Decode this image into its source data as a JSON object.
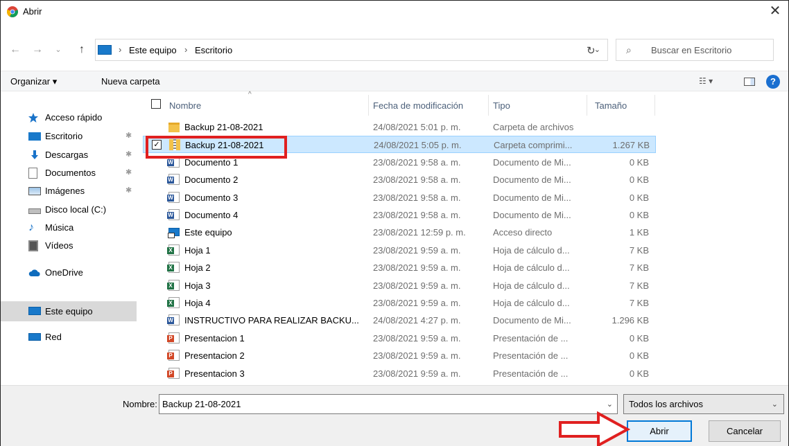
{
  "window": {
    "title": "Abrir",
    "close_glyph": "✕"
  },
  "nav": {
    "back_glyph": "←",
    "forward_glyph": "→",
    "recent_glyph": "⌄",
    "up_glyph": "↑",
    "breadcrumb_sep": "›",
    "breadcrumbs": [
      "Este equipo",
      "Escritorio"
    ],
    "dropdown_glyph": "⌄",
    "refresh_glyph": "↻",
    "search_glyph": "⌕",
    "search_placeholder": "Buscar en Escritorio"
  },
  "toolbar": {
    "organize_label": "Organizar ▾",
    "new_folder_label": "Nueva carpeta",
    "view_glyph": "☷ ▾",
    "help_glyph": "?"
  },
  "sidebar": {
    "items": [
      {
        "label": "Acceso rápido",
        "icon": "star-icon",
        "pinned": false
      },
      {
        "label": "Escritorio",
        "icon": "desktop-icon",
        "pinned": true
      },
      {
        "label": "Descargas",
        "icon": "download-icon",
        "pinned": true
      },
      {
        "label": "Documentos",
        "icon": "documents-icon",
        "pinned": true
      },
      {
        "label": "Imágenes",
        "icon": "pictures-icon",
        "pinned": true
      },
      {
        "label": "Disco local (C:)",
        "icon": "drive-icon",
        "pinned": false
      },
      {
        "label": "Música",
        "icon": "music-icon",
        "pinned": false
      },
      {
        "label": "Vídeos",
        "icon": "video-icon",
        "pinned": false
      },
      {
        "label": "OneDrive",
        "icon": "cloud-icon",
        "pinned": false
      },
      {
        "label": "Este equipo",
        "icon": "computer-icon",
        "pinned": false,
        "selected": true
      },
      {
        "label": "Red",
        "icon": "network-icon",
        "pinned": false
      }
    ],
    "pin_glyph": "📌"
  },
  "columns": {
    "name": "Nombre",
    "date": "Fecha de modificación",
    "type": "Tipo",
    "size": "Tamaño",
    "sort_glyph": "^"
  },
  "files": [
    {
      "name": "Backup 21-08-2021",
      "date": "24/08/2021 5:01 p. m.",
      "type": "Carpeta de archivos",
      "size": "",
      "icon": "folder-icon"
    },
    {
      "name": "Backup 21-08-2021",
      "date": "24/08/2021 5:05 p. m.",
      "type": "Carpeta comprimi...",
      "size": "1.267 KB",
      "icon": "zip-folder-icon",
      "selected": true
    },
    {
      "name": "Documento 1",
      "date": "23/08/2021 9:58 a. m.",
      "type": "Documento de Mi...",
      "size": "0 KB",
      "icon": "word-icon"
    },
    {
      "name": "Documento 2",
      "date": "23/08/2021 9:58 a. m.",
      "type": "Documento de Mi...",
      "size": "0 KB",
      "icon": "word-icon"
    },
    {
      "name": "Documento 3",
      "date": "23/08/2021 9:58 a. m.",
      "type": "Documento de Mi...",
      "size": "0 KB",
      "icon": "word-icon"
    },
    {
      "name": "Documento 4",
      "date": "23/08/2021 9:58 a. m.",
      "type": "Documento de Mi...",
      "size": "0 KB",
      "icon": "word-icon"
    },
    {
      "name": "Este equipo",
      "date": "23/08/2021 12:59 p. m.",
      "type": "Acceso directo",
      "size": "1 KB",
      "icon": "computer-shortcut-icon"
    },
    {
      "name": "Hoja 1",
      "date": "23/08/2021 9:59 a. m.",
      "type": "Hoja de cálculo d...",
      "size": "7 KB",
      "icon": "excel-icon"
    },
    {
      "name": "Hoja 2",
      "date": "23/08/2021 9:59 a. m.",
      "type": "Hoja de cálculo d...",
      "size": "7 KB",
      "icon": "excel-icon"
    },
    {
      "name": "Hoja 3",
      "date": "23/08/2021 9:59 a. m.",
      "type": "Hoja de cálculo d...",
      "size": "7 KB",
      "icon": "excel-icon"
    },
    {
      "name": "Hoja 4",
      "date": "23/08/2021 9:59 a. m.",
      "type": "Hoja de cálculo d...",
      "size": "7 KB",
      "icon": "excel-icon"
    },
    {
      "name": "INSTRUCTIVO PARA REALIZAR BACKU...",
      "date": "24/08/2021 4:27 p. m.",
      "type": "Documento de Mi...",
      "size": "1.296 KB",
      "icon": "word-icon"
    },
    {
      "name": "Presentacion 1",
      "date": "23/08/2021 9:59 a. m.",
      "type": "Presentación de ...",
      "size": "0 KB",
      "icon": "powerpoint-icon"
    },
    {
      "name": "Presentacion 2",
      "date": "23/08/2021 9:59 a. m.",
      "type": "Presentación de ...",
      "size": "0 KB",
      "icon": "powerpoint-icon"
    },
    {
      "name": "Presentacion 3",
      "date": "23/08/2021 9:59 a. m.",
      "type": "Presentación de ...",
      "size": "0 KB",
      "icon": "powerpoint-icon"
    }
  ],
  "bottom": {
    "name_label": "Nombre:",
    "name_value": "Backup 21-08-2021",
    "filter_value": "Todos los archivos",
    "open_label": "Abrir",
    "cancel_label": "Cancelar",
    "dropdown_glyph": "⌄"
  },
  "colors": {
    "annotation_red": "#e02020",
    "selection_bg": "#cce8ff",
    "accent": "#0078d7"
  }
}
